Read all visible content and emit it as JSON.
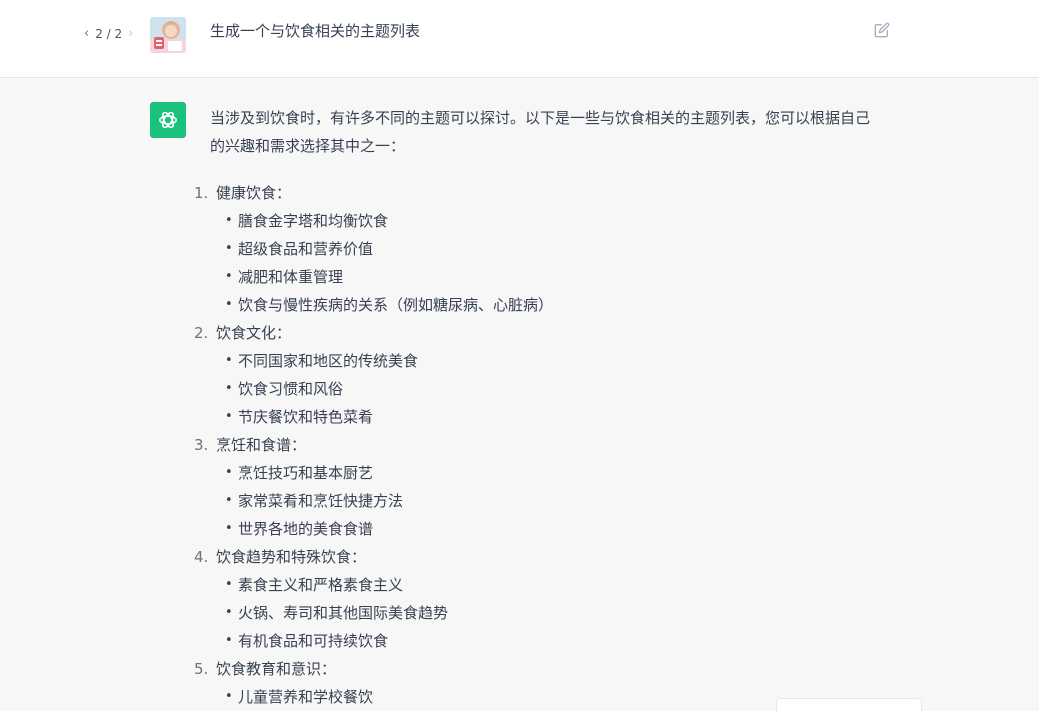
{
  "user_message": {
    "pager": {
      "prev": "‹",
      "count": "2 / 2",
      "next": "›"
    },
    "avatar_icon": "user-photo-avatar",
    "text": "生成一个与饮食相关的主题列表",
    "edit_icon": "edit-icon"
  },
  "assistant_message": {
    "avatar_icon": "openai-logo",
    "avatar_color": "#19c37d",
    "intro": "当涉及到饮食时，有许多不同的主题可以探讨。以下是一些与饮食相关的主题列表，您可以根据自己的兴趣和需求选择其中之一：",
    "topics": [
      {
        "num": "1.",
        "title": "健康饮食：",
        "items": [
          "膳食金字塔和均衡饮食",
          "超级食品和营养价值",
          "减肥和体重管理",
          "饮食与慢性疾病的关系（例如糖尿病、心脏病）"
        ]
      },
      {
        "num": "2.",
        "title": "饮食文化：",
        "items": [
          "不同国家和地区的传统美食",
          "饮食习惯和风俗",
          "节庆餐饮和特色菜肴"
        ]
      },
      {
        "num": "3.",
        "title": "烹饪和食谱：",
        "items": [
          "烹饪技巧和基本厨艺",
          "家常菜肴和烹饪快捷方法",
          "世界各地的美食食谱"
        ]
      },
      {
        "num": "4.",
        "title": "饮食趋势和特殊饮食：",
        "items": [
          "素食主义和严格素食主义",
          "火锅、寿司和其他国际美食趋势",
          "有机食品和可持续饮食"
        ]
      },
      {
        "num": "5.",
        "title": "饮食教育和意识：",
        "items": [
          "儿童营养和学校餐饮"
        ]
      }
    ]
  }
}
